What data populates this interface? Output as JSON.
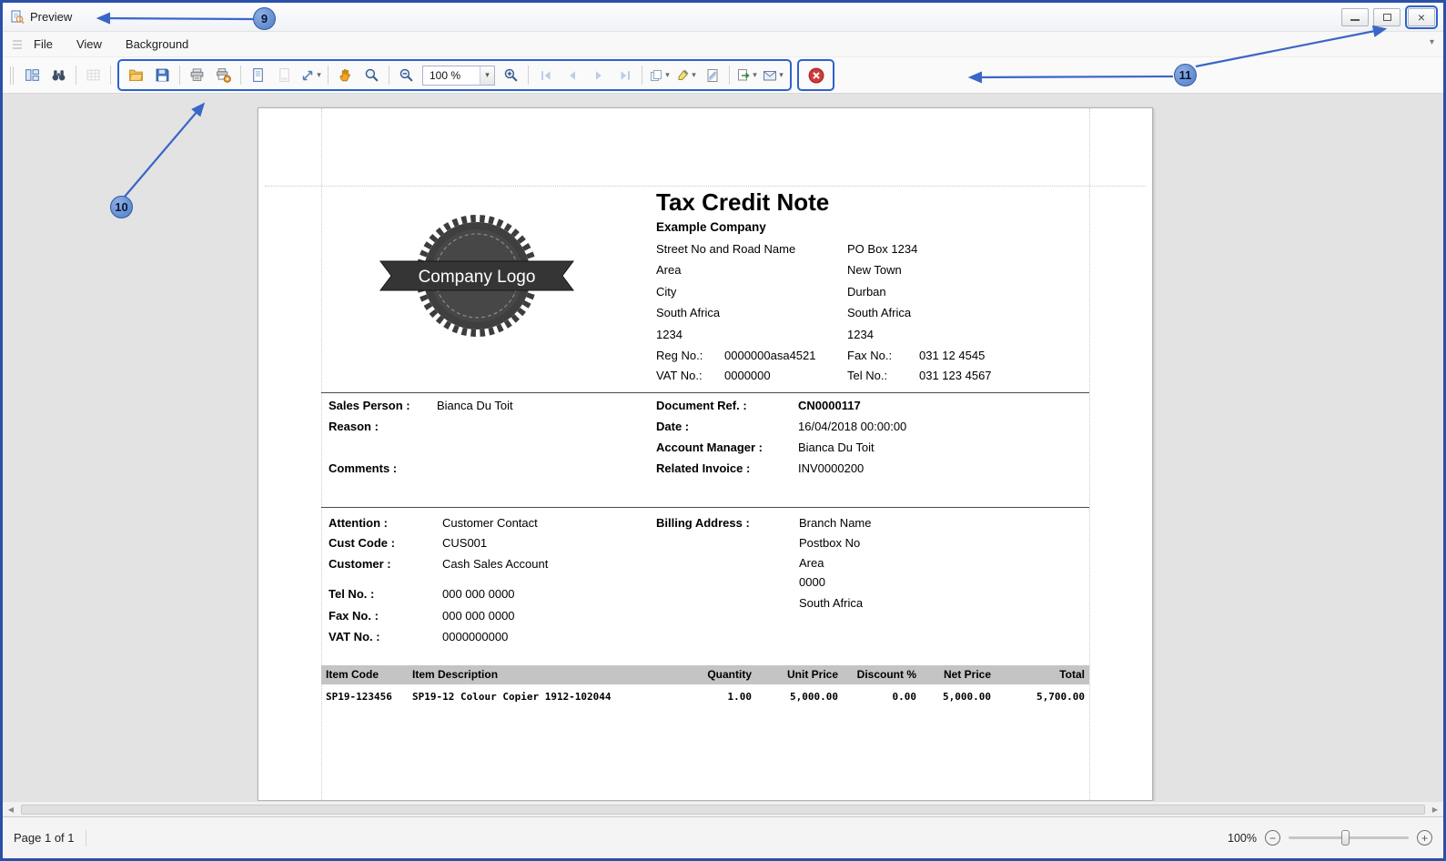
{
  "window": {
    "title": "Preview"
  },
  "menu": {
    "items": [
      "File",
      "View",
      "Background"
    ]
  },
  "toolbar": {
    "zoom_value": "100 %",
    "buttons": [
      "document-map",
      "search",
      "editing-fields",
      "open",
      "save",
      "print",
      "quick-print",
      "page-setup",
      "header-footer",
      "scale",
      "hand-tool",
      "magnifier",
      "zoom-out",
      "zoom-combobox",
      "zoom-in",
      "first-page",
      "previous-page",
      "next-page",
      "last-page",
      "multiple-pages",
      "page-color",
      "watermark",
      "export",
      "email",
      "close-preview"
    ]
  },
  "callouts": {
    "c9": "9",
    "c10": "10",
    "c11": "11"
  },
  "statusbar": {
    "page_info": "Page 1 of 1",
    "zoom_percent": "100%"
  },
  "icons": {
    "minimize": "",
    "maximize": "",
    "close": "×",
    "caret": "▾",
    "scroll_left": "◀",
    "scroll_right": "▶",
    "minus": "−",
    "plus": "+"
  },
  "colors": {
    "annotation_blue": "#2E62C9",
    "close_red": "#D03A3A",
    "window_border": "#2B50A8"
  },
  "doc": {
    "title": "Tax Credit Note",
    "company_name": "Example Company",
    "logo_text": "Company Logo",
    "address": {
      "left": [
        "Street No and Road Name",
        "Area",
        "City",
        "South Africa",
        "1234"
      ],
      "right": [
        "PO Box 1234",
        "New Town",
        "Durban",
        "South Africa",
        "1234"
      ],
      "reg_label": "Reg No.:",
      "reg_value": "0000000asa4521",
      "fax_label": "Fax No.:",
      "fax_value": "031 12 4545",
      "vat_label": "VAT No.:",
      "vat_value": "0000000",
      "tel_label": "Tel No.:",
      "tel_value": "031 123 4567"
    },
    "info": {
      "sales_person_label": "Sales Person :",
      "sales_person": "Bianca Du Toit",
      "reason_label": "Reason :",
      "comments_label": "Comments :",
      "doc_ref_label": "Document Ref. :",
      "doc_ref": "CN0000117",
      "date_label": "Date :",
      "date": "16/04/2018 00:00:00",
      "account_manager_label": "Account Manager :",
      "account_manager": "Bianca Du Toit",
      "related_invoice_label": "Related Invoice :",
      "related_invoice": "INV0000200"
    },
    "customer": {
      "attention_label": "Attention :",
      "attention": "Customer Contact",
      "cust_code_label": "Cust Code :",
      "cust_code": "CUS001",
      "customer_label": "Customer :",
      "customer": "Cash Sales Account",
      "tel_label": "Tel No. :",
      "tel": "000 000 0000",
      "fax_label": "Fax No. :",
      "fax": "000 000 0000",
      "vat_label": "VAT No. :",
      "vat": "0000000000",
      "billing_label": "Billing Address :",
      "billing_lines": [
        "Branch Name",
        "Postbox No",
        "Area",
        "0000",
        "South Africa"
      ]
    },
    "table": {
      "headers": [
        "Item Code",
        "Item Description",
        "Quantity",
        "Unit Price",
        "Discount %",
        "Net Price",
        "Total"
      ],
      "rows": [
        [
          "SP19-123456",
          "SP19-12 Colour Copier 1912-102044",
          "1.00",
          "5,000.00",
          "0.00",
          "5,000.00",
          "5,700.00"
        ]
      ]
    }
  }
}
